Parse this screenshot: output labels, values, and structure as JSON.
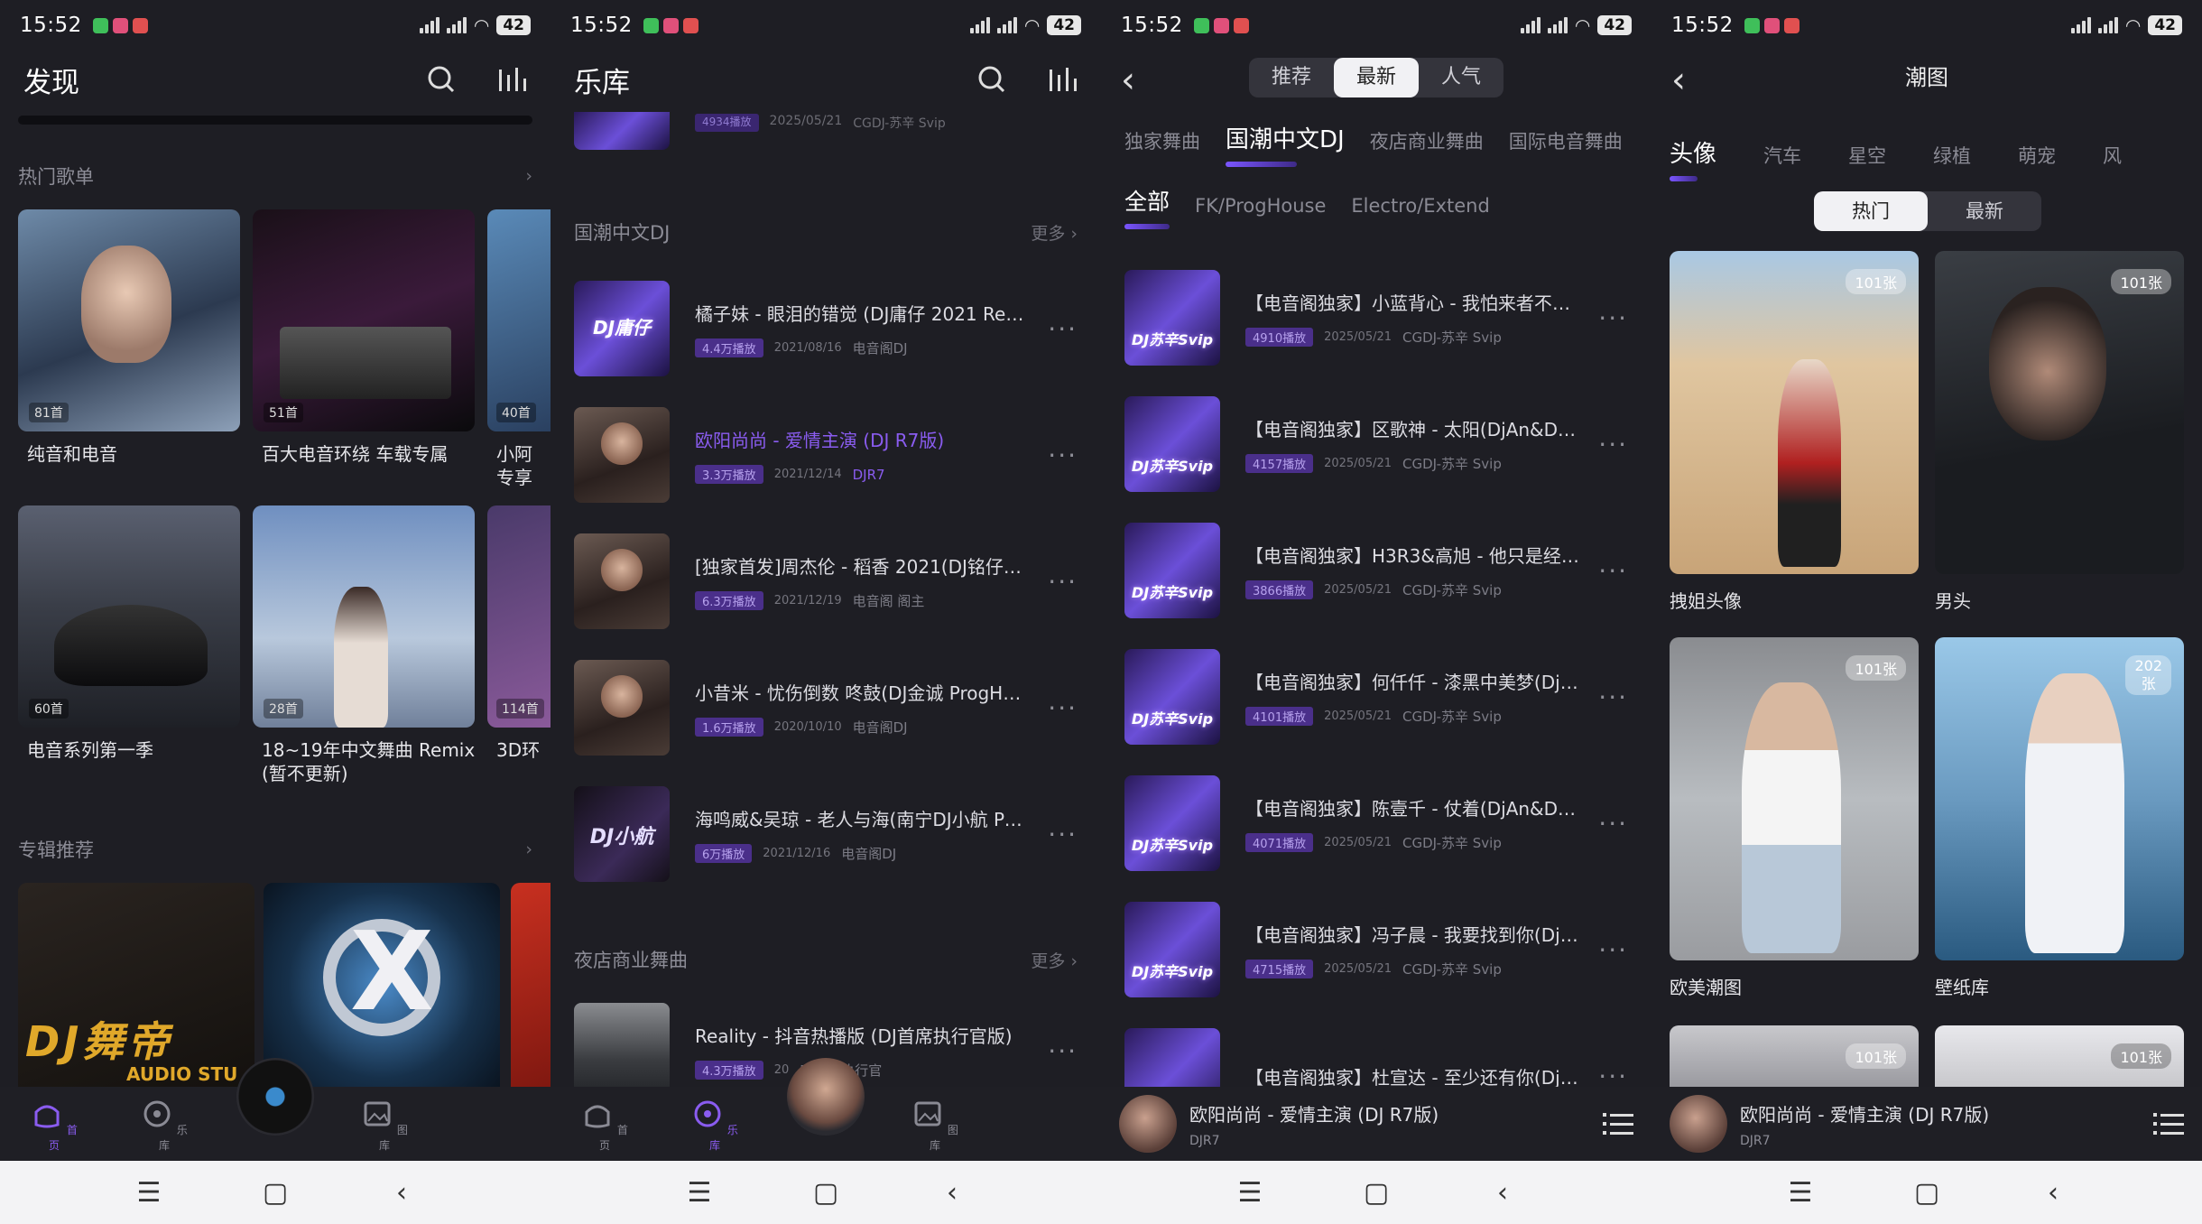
{
  "status": {
    "time": "15:52",
    "battery": "42"
  },
  "screen1": {
    "title": "发现",
    "section_hot": "热门歌单",
    "section_album": "专辑推荐",
    "playlists": [
      {
        "label": "纯音和电音",
        "count": "81首"
      },
      {
        "label": "百大电音环绕 车载专属",
        "count": "51首"
      },
      {
        "label": "小阿\n专享",
        "count": "40首"
      },
      {
        "label": "电音系列第一季",
        "count": "60首"
      },
      {
        "label": "18~19年中文舞曲 Remix\n(暂不更新)",
        "count": "28首"
      },
      {
        "label": "3D环",
        "count": "114首"
      }
    ],
    "album_text": "DJ舞帝",
    "album_sub": "AUDIO STU",
    "nav": [
      {
        "label": "首页"
      },
      {
        "label": "乐库"
      },
      {
        "label": "图库"
      }
    ]
  },
  "screen2": {
    "title": "乐库",
    "top_partial": {
      "name": "",
      "plays": "4934播放",
      "date": "2025/05/21",
      "artist": "CGDJ-苏辛 Svip"
    },
    "section1": "国潮中文DJ",
    "section2": "夜店商业舞曲",
    "more": "更多",
    "songs": [
      {
        "name": "橘子妹 - 眼泪的错觉 (DJ庸仔 2021 Remix)",
        "plays": "4.4万播放",
        "date": "2021/08/16",
        "artist": "电音阁DJ",
        "cover_text": "DJ庸仔"
      },
      {
        "name": "欧阳尚尚 - 爱情主演 (DJ R7版)",
        "plays": "3.3万播放",
        "date": "2021/12/14",
        "artist": "DJR7"
      },
      {
        "name": "[独家首发]周杰伦 - 稻香 2021(DJ铭仔DJ...",
        "plays": "6.3万播放",
        "date": "2021/12/19",
        "artist": "电音阁 阁主"
      },
      {
        "name": "小昔米 - 忧伤倒数 咚鼓(DJ金诚 ProgHou...",
        "plays": "1.6万播放",
        "date": "2020/10/10",
        "artist": "电音阁DJ"
      },
      {
        "name": "海鸣威&吴琼 - 老人与海(南宁DJ小航 Prog...",
        "plays": "6万播放",
        "date": "2021/12/16",
        "artist": "电音阁DJ",
        "cover_text": "DJ小航"
      },
      {
        "name": "Reality - 抖音热播版 (DJ首席执行官版)",
        "plays": "4.3万播放",
        "date": "20",
        "artist": "DJ首席执行官"
      }
    ],
    "nav": [
      {
        "label": "首页"
      },
      {
        "label": "乐库"
      },
      {
        "label": "图库"
      }
    ]
  },
  "screen3": {
    "seg": [
      "推荐",
      "最新",
      "人气"
    ],
    "tabs": [
      "独家舞曲",
      "国潮中文DJ",
      "夜店商业舞曲",
      "国际电音舞曲"
    ],
    "subtabs": [
      "全部",
      "FK/ProgHouse",
      "Electro/Extend"
    ],
    "cover_text": "DJ苏辛Svip",
    "songs": [
      {
        "name": "【电音阁独家】小蓝背心 - 我怕来者不是你...",
        "plays": "4910播放",
        "date": "2025/05/21",
        "artist": "CGDJ-苏辛 Svip"
      },
      {
        "name": "【电音阁独家】区歌神 - 太阳(DjAn&Dj苏...",
        "plays": "4157播放",
        "date": "2025/05/21",
        "artist": "CGDJ-苏辛 Svip"
      },
      {
        "name": "【电音阁独家】H3R3&高旭 - 他只是经过(...",
        "plays": "3866播放",
        "date": "2025/05/21",
        "artist": "CGDJ-苏辛 Svip"
      },
      {
        "name": "【电音阁独家】何仟仟 - 漆黑中美梦(DjAn...",
        "plays": "4101播放",
        "date": "2025/05/21",
        "artist": "CGDJ-苏辛 Svip"
      },
      {
        "name": "【电音阁独家】陈壹千 - 仗着(DjAn&Dj苏...",
        "plays": "4071播放",
        "date": "2025/05/21",
        "artist": "CGDJ-苏辛 Svip"
      },
      {
        "name": "【电音阁独家】冯子晨 - 我要找到你(DjAn...",
        "plays": "4715播放",
        "date": "2025/05/21",
        "artist": "CGDJ-苏辛 Svip"
      },
      {
        "name": "【电音阁独家】杜宣达 - 至少还有你(DjAn...",
        "plays": "",
        "date": "",
        "artist": ""
      }
    ],
    "player": {
      "name": "欧阳尚尚 - 爱情主演 (DJ R7版)",
      "artist": "DJR7"
    }
  },
  "screen4": {
    "title": "潮图",
    "tabs": [
      "头像",
      "汽车",
      "星空",
      "绿植",
      "萌宠",
      "风"
    ],
    "seg": [
      "热门",
      "最新"
    ],
    "images": [
      {
        "label": "拽姐头像",
        "count": "101张"
      },
      {
        "label": "男头",
        "count": "101张"
      },
      {
        "label": "欧美潮图",
        "count": "101张"
      },
      {
        "label": "壁纸库",
        "count": "202\n张"
      },
      {
        "label": "",
        "count": "101张"
      },
      {
        "label": "",
        "count": "101张"
      }
    ],
    "player": {
      "name": "欧阳尚尚 - 爱情主演 (DJ R7版)",
      "artist": "DJR7"
    }
  },
  "colors": {
    "accent": "#8a5cf0",
    "bg": "#1e1e24"
  }
}
